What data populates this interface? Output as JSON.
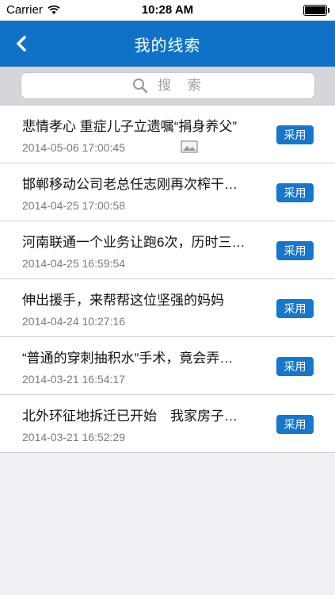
{
  "status_bar": {
    "carrier": "Carrier",
    "time": "10:28 AM"
  },
  "nav": {
    "title": "我的线索"
  },
  "search": {
    "placeholder": "搜 索"
  },
  "items": [
    {
      "title": "悲情孝心 重症儿子立遗嘱“捐身养父”",
      "date": "2014-05-06 17:00:45",
      "button": "采用"
    },
    {
      "title": "邯郸移动公司老总任志刚再次榨干…",
      "date": "2014-04-25 17:00:58",
      "button": "采用"
    },
    {
      "title": "河南联通一个业务让跑6次，历时三…",
      "date": "2014-04-25 16:59:54",
      "button": "采用"
    },
    {
      "title": "伸出援手，来帮帮这位坚强的妈妈",
      "date": "2014-04-24 10:27:16",
      "button": "采用"
    },
    {
      "title": "“普通的穿刺抽积水”手术，竟会弄…",
      "date": "2014-03-21 16:54:17",
      "button": "采用"
    },
    {
      "title": "北外环征地拆迁已开始　我家房子…",
      "date": "2014-03-21 16:52:29",
      "button": "采用"
    }
  ]
}
